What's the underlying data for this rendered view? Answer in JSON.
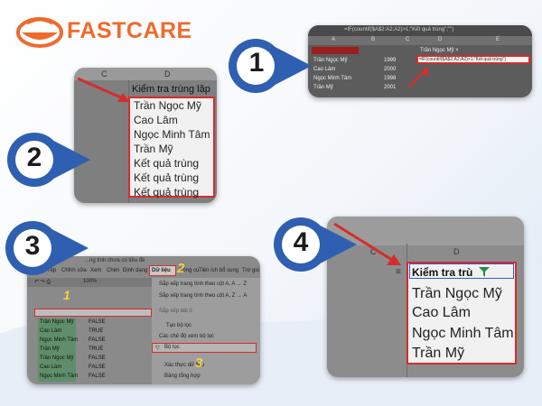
{
  "brand": {
    "name": "FASTCARE"
  },
  "steps": {
    "s1": "1",
    "s2": "2",
    "s3": "3",
    "s4": "4"
  },
  "panel1": {
    "formula": "=IF(countif($A$2:A2;A2)>1;\"Kết quả trùng\";\"\")",
    "formula_cell": "=IF(countif($A$2:A2;A2)>1;\"Kết quả trùng\")",
    "header_cell": "Trần Ngọc Mỹ ×",
    "cols": [
      "A",
      "B",
      "C",
      "D",
      "E"
    ],
    "rows": [
      {
        "name": "Trần Ngọc Mỹ",
        "year": "1999"
      },
      {
        "name": "Cao Lâm",
        "year": "2000"
      },
      {
        "name": "Ngọc Minh Tâm",
        "year": "1998"
      },
      {
        "name": "Trần Mỹ",
        "year": "2001"
      }
    ]
  },
  "panel2": {
    "col_c": "C",
    "col_d": "D",
    "header": "Kiểm tra trùng lặp",
    "rows": [
      "Trần Ngọc Mỹ",
      "Cao Lâm",
      "Ngọc Minh Tâm",
      "Trần Mỹ",
      "Kết quả trùng",
      "Kết quả trùng",
      "Kết quả trùng"
    ]
  },
  "panel3": {
    "doc_title": "...ng tính chưa có tiêu đề",
    "menus": [
      "Tệp",
      "Chỉnh sửa",
      "Xem",
      "Chèn",
      "Định dạng",
      "Dữ liệu",
      "Công cụ",
      "Tiện ích bổ sung",
      "Trợ giú"
    ],
    "active_menu": "Dữ liệu",
    "zoom": "100%",
    "label_1": "1",
    "label_2": "2",
    "label_3": "3",
    "rows": [
      {
        "name": "Trần Ngọc Mỹ",
        "val": "FALSE"
      },
      {
        "name": "Cao Lâm",
        "val": "TRUE"
      },
      {
        "name": "Ngọc Minh Tâm",
        "val": "FALSE"
      },
      {
        "name": "Trần Mỹ",
        "val": "TRUE"
      },
      {
        "name": "Trần Ngọc Mỹ",
        "val": "FALSE"
      },
      {
        "name": "Cao Lâm",
        "val": "FALSE"
      },
      {
        "name": "Ngọc Minh Tâm",
        "val": "FALSE"
      }
    ],
    "dropdown": {
      "sort_az": "Sắp xếp trang tính theo cột A, A → Z",
      "sort_za": "Sắp xếp trang tính theo cột A, Z → A",
      "sort_range": "Sắp xếp dải ô",
      "create_filter": "Tạo bộ lọc",
      "filter_views": "Các chế độ xem bộ lọc",
      "slicer": "Bộ lọc",
      "validation": "Xác thực dữ liệu",
      "pivot": "Bảng tổng hợp"
    }
  },
  "panel4": {
    "cols": [
      "C",
      "D"
    ],
    "header": "Kiểm tra trù",
    "rows": [
      "Trần Ngọc Mỹ",
      "Cao Lâm",
      "Ngọc Minh Tâm",
      "Trần Mỹ"
    ]
  },
  "colors": {
    "accent": "#ef6a2d",
    "badge": "#2f5fb0",
    "red": "#d62c2c",
    "filter": "#1e8e3e"
  }
}
